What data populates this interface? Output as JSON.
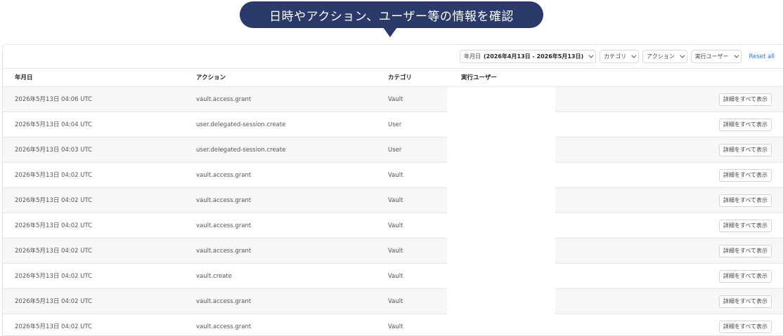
{
  "callout": {
    "text": "日時やアクション、ユーザー等の情報を確認"
  },
  "filters": {
    "date_label": "年月日",
    "date_range": "(2026年4月13日 - 2026年5月13日)",
    "category": "カテゴリ",
    "action": "アクション",
    "user": "実行ユーザー",
    "reset": "Reset all"
  },
  "columns": {
    "date": "年月日",
    "action": "アクション",
    "category": "カテゴリ",
    "user": "実行ユーザー"
  },
  "rows": [
    {
      "date": "2026年5月13日 04:06 UTC",
      "action": "vault.access.grant",
      "category": "Vault",
      "detail": "詳細をすべて表示"
    },
    {
      "date": "2026年5月13日 04:04 UTC",
      "action": "user.delegated-session.create",
      "category": "User",
      "detail": "詳細をすべて表示"
    },
    {
      "date": "2026年5月13日 04:03 UTC",
      "action": "user.delegated-session.create",
      "category": "User",
      "detail": "詳細をすべて表示"
    },
    {
      "date": "2026年5月13日 04:02 UTC",
      "action": "vault.access.grant",
      "category": "Vault",
      "detail": "詳細をすべて表示"
    },
    {
      "date": "2026年5月13日 04:02 UTC",
      "action": "vault.access.grant",
      "category": "Vault",
      "detail": "詳細をすべて表示"
    },
    {
      "date": "2026年5月13日 04:02 UTC",
      "action": "vault.access.grant",
      "category": "Vault",
      "detail": "詳細をすべて表示"
    },
    {
      "date": "2026年5月13日 04:02 UTC",
      "action": "vault.access.grant",
      "category": "Vault",
      "detail": "詳細をすべて表示"
    },
    {
      "date": "2026年5月13日 04:02 UTC",
      "action": "vault.create",
      "category": "Vault",
      "detail": "詳細をすべて表示"
    },
    {
      "date": "2026年5月13日 04:02 UTC",
      "action": "vault.access.grant",
      "category": "Vault",
      "detail": "詳細をすべて表示"
    },
    {
      "date": "2026年5月13日 04:02 UTC",
      "action": "vault.access.grant",
      "category": "Vault",
      "detail": "詳細をすべて表示"
    }
  ]
}
